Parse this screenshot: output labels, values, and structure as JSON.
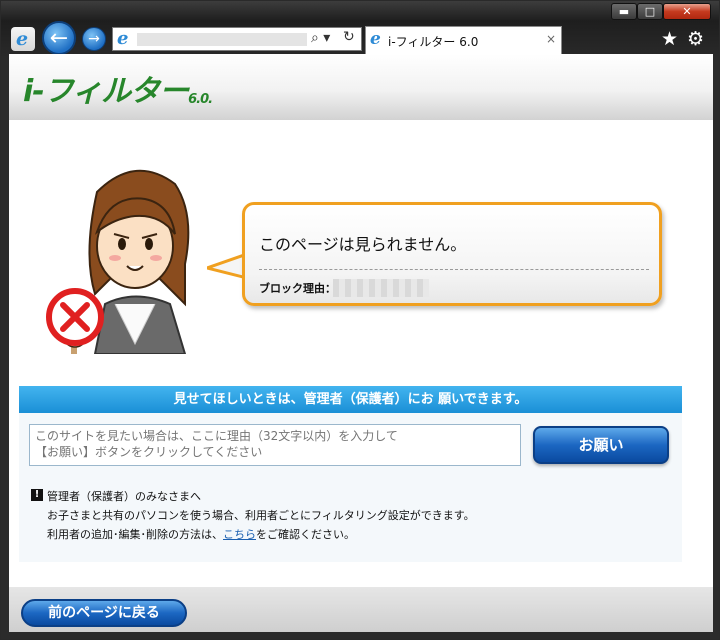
{
  "window": {
    "minimize_glyph": "▬",
    "maximize_glyph": "□",
    "close_glyph": "✕"
  },
  "toolbar": {
    "ie_logo_glyph": "e",
    "back_glyph": "←",
    "forward_glyph": "→",
    "search_glyph": "⌕ ▾",
    "refresh_glyph": "↻"
  },
  "tab": {
    "title": "i-フィルター 6.0",
    "close_glyph": "×"
  },
  "favorites_glyph": "★",
  "tools_glyph": "⚙",
  "brand": {
    "logo_text": "i-フィルター",
    "logo_version": "6.0."
  },
  "block": {
    "title": "このページは見られません。",
    "reason_label": "ブロック理由："
  },
  "request": {
    "banner": "見せてほしいときは、管理者（保護者）にお 願いできます。",
    "placeholder": "このサイトを見たい場合は、ここに理由（32文字以内）を入力して\n【お願い】ボタンをクリックしてください",
    "button_label": "お願い"
  },
  "notice": {
    "icon_glyph": "!",
    "title": "管理者（保護者）のみなさまへ",
    "line1": "お子さまと共有のパソコンを使う場合、利用者ごとにフィルタリング設定ができます。",
    "line2_pre": "利用者の追加･編集･削除の方法は、",
    "line2_link": "こちら",
    "line2_post": "をご確認ください。"
  },
  "footer": {
    "back_button_label": "前のページに戻る"
  },
  "colors": {
    "accent_blue": "#1a8fd6",
    "bubble_border": "#f0a020",
    "logo_green": "#27862b",
    "no_sign_red": "#e02020"
  }
}
